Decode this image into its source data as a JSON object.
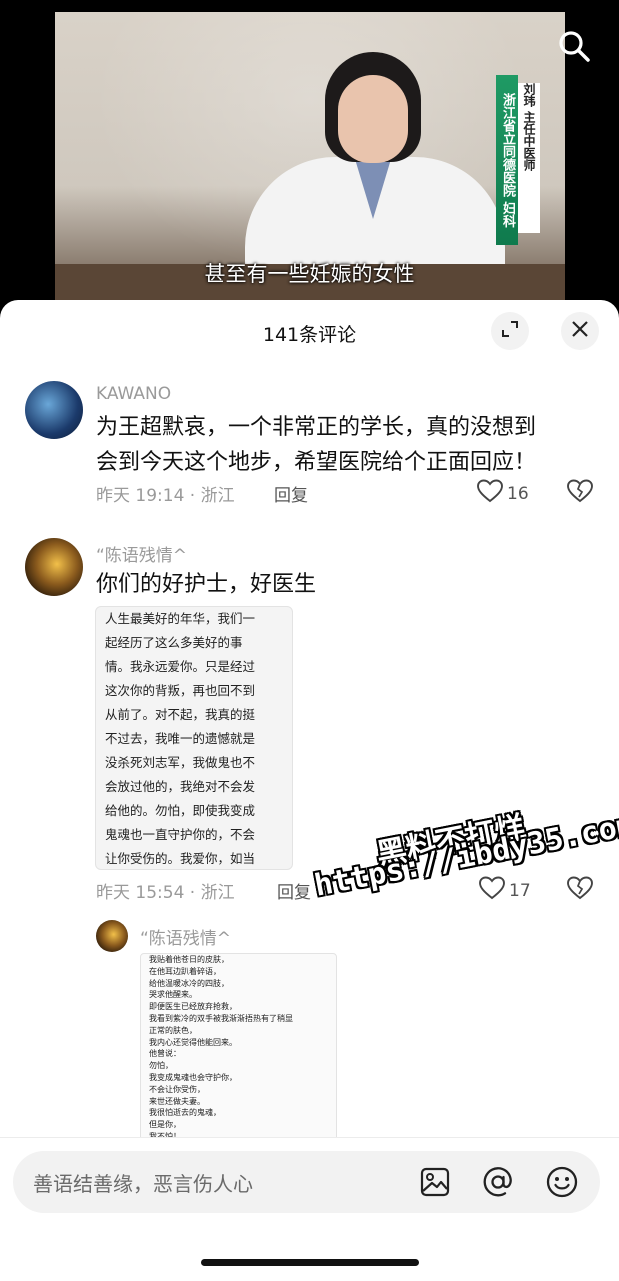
{
  "video": {
    "subtitle": "甚至有一些妊娠的女性",
    "nameplate_org": "浙江省立同德医院 妇科",
    "nameplate_name": "刘玮 主任中医师"
  },
  "sheet": {
    "title": "141条评论"
  },
  "comments": [
    {
      "username": "KAWANO",
      "text_line1": "为王超默哀，一个非常正的学长，真的没想到",
      "text_line2": "会到今天这个地步，希望医院给个正面回应！",
      "meta": "昨天 19:14 · 浙江",
      "reply_label": "回复",
      "likes": "16"
    },
    {
      "username": "“陈语残情^",
      "text": "你们的好护士，好医生",
      "image_text": "人生最美好的年华，我们一\n起经历了这么多美好的事\n情。我永远爱你。只是经过\n这次你的背叛，再也回不到\n从前了。对不起，我真的挺\n不过去，我唯一的遗憾就是\n没杀死刘志军，我做鬼也不\n会放过他的，我绝对不会发\n给他的。勿怕，即使我变成\n鬼魂也一直守护你的，不会\n让你受伤的。我爱你，如当\n初。我们来生再做夫妻。",
      "meta": "昨天 15:54 · 浙江",
      "reply_label": "回复",
      "likes": "17"
    }
  ],
  "nested_reply": {
    "username": "“陈语残情^",
    "image_text": "我贴着他苍日的皮肤，\n在他耳边趴着碎语，\n给他温暖冰冷的四肢，\n哭求他醒来。\n即便医生已经放弃抢救，\n我看到紫冷的双手被我渐渐捂热有了稍显\n正常的肤色，\n我内心还觉得他能回来。\n他曾说：\n勿怕，\n我变成鬼魂也会守护你，\n不会让你受伤，\n来世还做夫妻。\n我很怕逝去的鬼魂，\n但是你，\n我不怕！"
  },
  "watermark": {
    "line1": "黑料不打烊",
    "line2": "https://ibdy35.com"
  },
  "composer": {
    "placeholder": "善语结善缘，恶言伤人心"
  },
  "icons": {
    "search": "search-icon",
    "expand": "expand-icon",
    "close": "close-icon",
    "heart": "heart-icon",
    "broken_heart": "broken-heart-icon",
    "image": "image-icon",
    "mention": "at-icon",
    "emoji": "emoji-icon"
  }
}
